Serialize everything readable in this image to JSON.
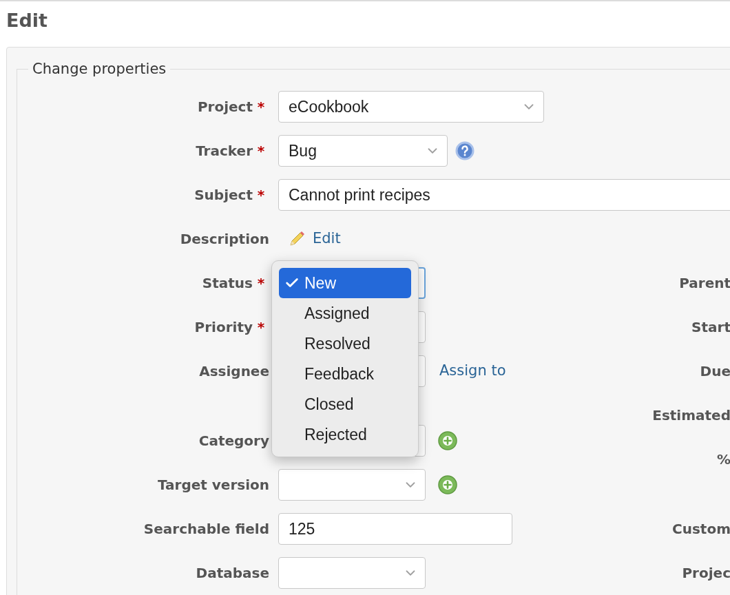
{
  "page_title": "Edit",
  "fieldset": {
    "legend": "Change properties"
  },
  "top_fields": [
    {
      "kind": "select",
      "label": "Project",
      "required_mark": "*",
      "value": "eCookbook"
    },
    {
      "kind": "select",
      "label": "Tracker",
      "required_mark": "*",
      "value": "Bug",
      "help": true
    },
    {
      "kind": "text",
      "label": "Subject",
      "required_mark": "*",
      "value": "Cannot print recipes"
    },
    {
      "kind": "link",
      "label": "Description",
      "link": "Edit"
    }
  ],
  "left_fields": [
    {
      "label": "Status",
      "required_mark": "*",
      "focused": true
    },
    {
      "label": "Priority",
      "required_mark": "*",
      "focused": false
    },
    {
      "label": "Assignee",
      "focused": false,
      "link": "Assign to"
    },
    {
      "label": "Category",
      "focused": false,
      "add": true
    },
    {
      "label": "Target version",
      "focused": false,
      "add": true
    }
  ],
  "right_fields": [
    {
      "label": "Parent"
    },
    {
      "label": "Start"
    },
    {
      "label": "Due"
    },
    {
      "label": "Estimated"
    },
    {
      "label": "%"
    }
  ],
  "custom_left": [
    {
      "kind": "text",
      "label": "Searchable field",
      "value": "125"
    },
    {
      "kind": "select",
      "label": "Database"
    }
  ],
  "custom_right": [
    {
      "label": "Custom"
    },
    {
      "label": "Projec"
    }
  ],
  "status_menu": {
    "options": [
      {
        "label": "New",
        "selected": true
      },
      {
        "label": "Assigned",
        "selected": false
      },
      {
        "label": "Resolved",
        "selected": false
      },
      {
        "label": "Feedback",
        "selected": false
      },
      {
        "label": "Closed",
        "selected": false
      },
      {
        "label": "Rejected",
        "selected": false
      }
    ]
  }
}
